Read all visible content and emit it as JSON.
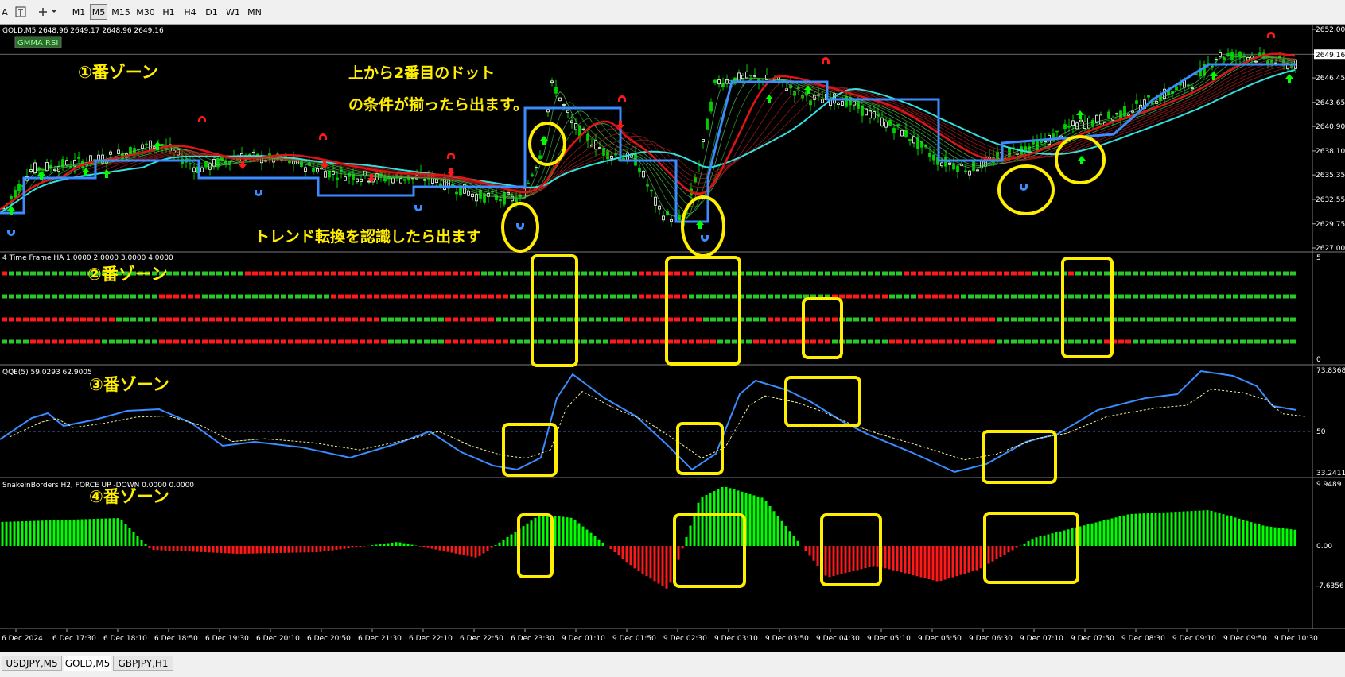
{
  "toolbar": {
    "timeframes": [
      "M1",
      "M5",
      "M15",
      "M30",
      "H1",
      "H4",
      "D1",
      "W1",
      "MN"
    ],
    "active_timeframe": "M5",
    "left_glyph": "A"
  },
  "main": {
    "symbol_info": "GOLD,M5  2648.96 2649.17 2648.96 2649.16",
    "indicator_label": "GMMA RSI",
    "zone_label": "①番ゾーン",
    "note_line1": "上から2番目のドット",
    "note_line2": "の条件が揃ったら出ます。",
    "note_bottom": "トレンド転換を認識したら出ます",
    "price_ticks": [
      "2652.00",
      "2649.16",
      "2646.45",
      "2643.65",
      "2640.90",
      "2638.10",
      "2635.35",
      "2632.55",
      "2629.75",
      "2627.00"
    ],
    "current_price": "2649.16"
  },
  "panel2": {
    "title": "4 Time Frame HA 1.0000 2.0000 3.0000 4.0000",
    "zone_label": "②番ゾーン",
    "scale_top": "5",
    "scale_bottom": "0"
  },
  "panel3": {
    "title": "QQE(5) 59.0293 62.9005",
    "zone_label": "③番ゾーン",
    "scale_top": "73.8368",
    "scale_mid": "50",
    "scale_bottom": "33.2411"
  },
  "panel4": {
    "title": "SnakeInBorders H2, FORCE UP -DOWN  0.0000 0.0000",
    "zone_label": "④番ゾーン",
    "scale_top": "9.9489",
    "scale_mid": "0.00",
    "scale_bottom": "-7.6356"
  },
  "time_axis": [
    "6 Dec 2024",
    "6 Dec 17:30",
    "6 Dec 18:10",
    "6 Dec 18:50",
    "6 Dec 19:30",
    "6 Dec 20:10",
    "6 Dec 20:50",
    "6 Dec 21:30",
    "6 Dec 22:10",
    "6 Dec 22:50",
    "6 Dec 23:30",
    "9 Dec 01:10",
    "9 Dec 01:50",
    "9 Dec 02:30",
    "9 Dec 03:10",
    "9 Dec 03:50",
    "9 Dec 04:30",
    "9 Dec 05:10",
    "9 Dec 05:50",
    "9 Dec 06:30",
    "9 Dec 07:10",
    "9 Dec 07:50",
    "9 Dec 08:30",
    "9 Dec 09:10",
    "9 Dec 09:50",
    "9 Dec 10:30"
  ],
  "tabs": [
    "USDJPY,M5",
    "GOLD,M5",
    "GBPJPY,H1"
  ],
  "active_tab": "GOLD,M5",
  "colors": {
    "background": "#000000",
    "bull": "#00ff00",
    "bear": "#ff1a1a",
    "ema_fast": "#3a8cff",
    "ema_slow": "#33e0e0",
    "trend_red": "#e01414",
    "highlight": "#ffee00",
    "grid": "#808080"
  },
  "icons": [
    "chart-type-icon",
    "crosshair-icon",
    "up-arrow-icon",
    "down-arrow-icon",
    "circle-highlight-icon"
  ]
}
